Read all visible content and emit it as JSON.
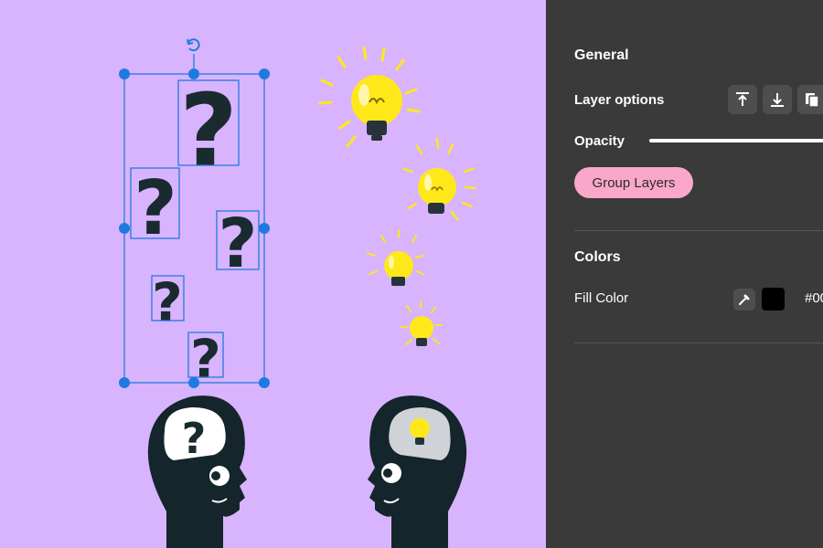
{
  "canvas": {
    "background": "#d8b4fe",
    "rotate_icon": "rotate-icon",
    "selection_color": "#1f7ae0",
    "question_glyph": "?",
    "head_color": "#14252b",
    "bulb_color": "#ffe81a"
  },
  "panel": {
    "general_title": "General",
    "layer_options_label": "Layer options",
    "layer_buttons": [
      "bring-to-front-icon",
      "send-to-back-icon",
      "duplicate-icon"
    ],
    "opacity_label": "Opacity",
    "opacity_value": 1.0,
    "group_layers_label": "Group Layers",
    "colors_title": "Colors",
    "fill_color_label": "Fill Color",
    "fill_color_swatch": "#000000",
    "fill_color_hex": "#00"
  }
}
